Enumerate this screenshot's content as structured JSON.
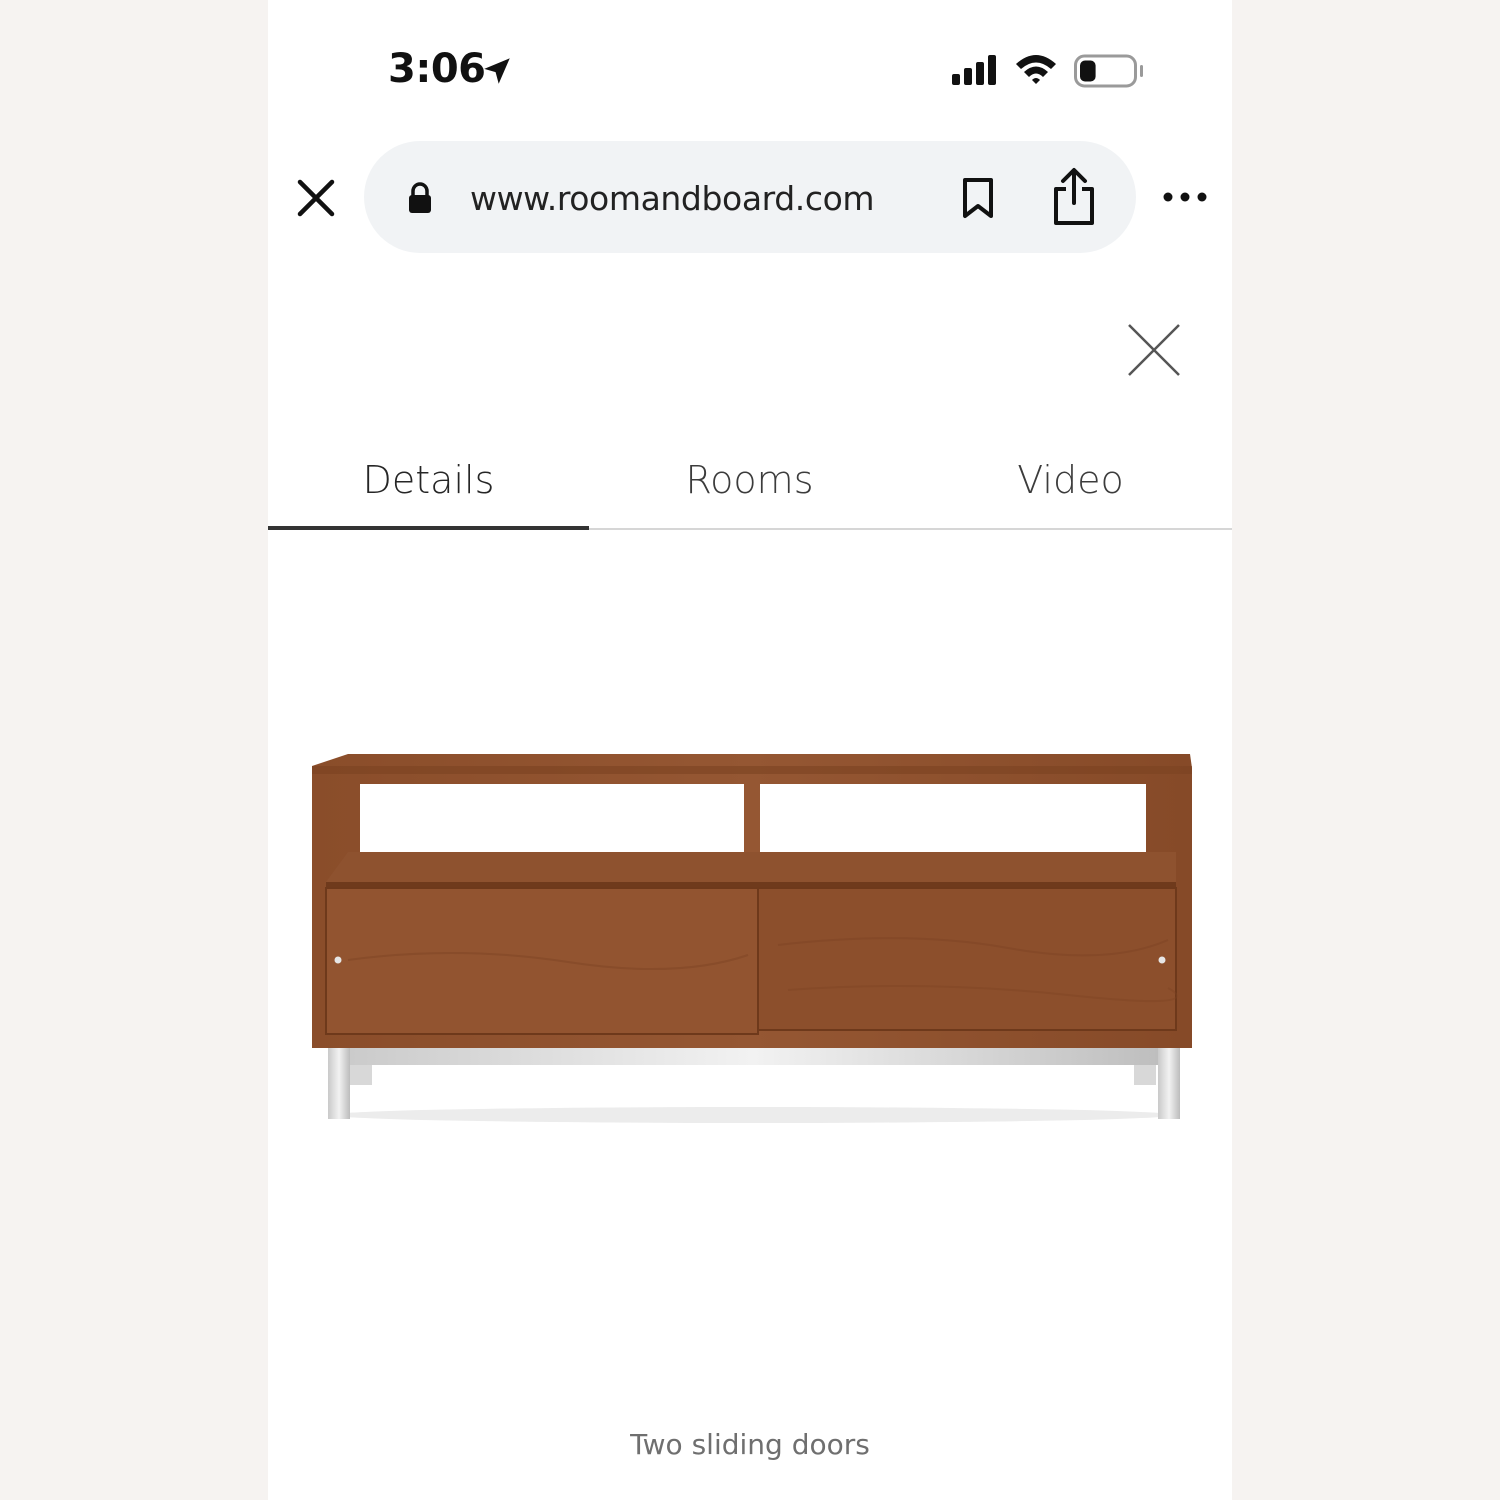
{
  "status_bar": {
    "time": "3:06",
    "icons": [
      "location-arrow-icon",
      "cellular-signal-icon",
      "wifi-icon",
      "battery-icon"
    ],
    "battery_level": 0.3
  },
  "browser": {
    "url": "www.roomandboard.com",
    "icons": [
      "close-icon",
      "lock-icon",
      "bookmark-icon",
      "share-icon",
      "more-icon"
    ]
  },
  "tabs": [
    {
      "label": "Details",
      "active": true
    },
    {
      "label": "Rooms",
      "active": false
    },
    {
      "label": "Video",
      "active": false
    }
  ],
  "product": {
    "caption": "Two sliding doors"
  },
  "colors": {
    "wood": "#8b4f2a",
    "background": "#ffffff",
    "url_bar": "#f1f3f5",
    "page_outer": "#f6f3f1"
  }
}
